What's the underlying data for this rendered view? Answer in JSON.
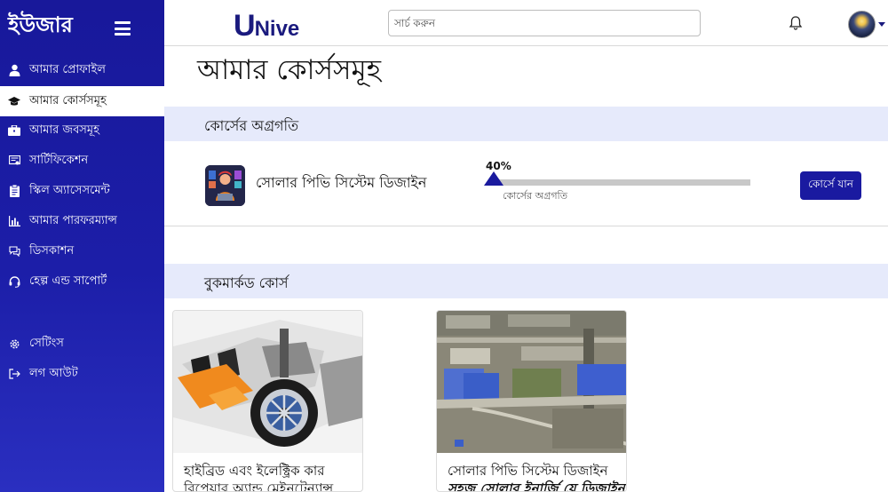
{
  "sidebar": {
    "title": "ইউজার",
    "items": [
      {
        "label": "আমার প্রোফাইল",
        "icon": "user-icon"
      },
      {
        "label": "আমার কোর্সসমূহ",
        "icon": "graduation-cap-icon",
        "active": true
      },
      {
        "label": "আমার জবসমূহ",
        "icon": "briefcase-icon"
      },
      {
        "label": "সার্টিফিকেশন",
        "icon": "certificate-icon"
      },
      {
        "label": "স্কিল অ্যাসেসমেন্ট",
        "icon": "clipboard-icon"
      },
      {
        "label": "আমার পারফরম্যান্স",
        "icon": "bar-chart-icon"
      },
      {
        "label": "ডিসকাশন",
        "icon": "chat-icon"
      },
      {
        "label": "হেল্প এন্ড সাপোর্ট",
        "icon": "headset-icon"
      },
      {
        "label": "সেটিংস",
        "icon": "gear-icon"
      },
      {
        "label": "লগ আউট",
        "icon": "logout-icon"
      }
    ]
  },
  "header": {
    "logo_u": "U",
    "logo_rest": "Nive",
    "search_placeholder": "সার্চ করুন"
  },
  "main": {
    "page_title": "আমার কোর্সসমূহ",
    "progress_section": {
      "title": "কোর্সের অগ্রগতি",
      "course_name": "সোলার পিভি সিস্টেম ডিজাইন",
      "progress_label": "40%",
      "progress_value": 0.4,
      "progress_caption": "কোর্সের অগ্রগতি",
      "button_label": "কোর্সে যান"
    },
    "bookmark_section": {
      "title": "বুকমার্কড কোর্স",
      "cards": [
        {
          "title_line1": "হাইব্রিড এবং ইলেক্ট্রিক কার",
          "title_line2": "রিপেয়ার অ্যান্ড মেইনটেন্যান্স"
        },
        {
          "title_line1": "সোলার পিভি সিস্টেম ডিজাইন",
          "title_line2": "সহজ সোলার ইনার্জি যে ডিজাইন"
        }
      ]
    }
  },
  "colors": {
    "sidebar": "#1c1ea8",
    "accent": "#1a1aa0",
    "section_bg": "#e6eafb"
  }
}
